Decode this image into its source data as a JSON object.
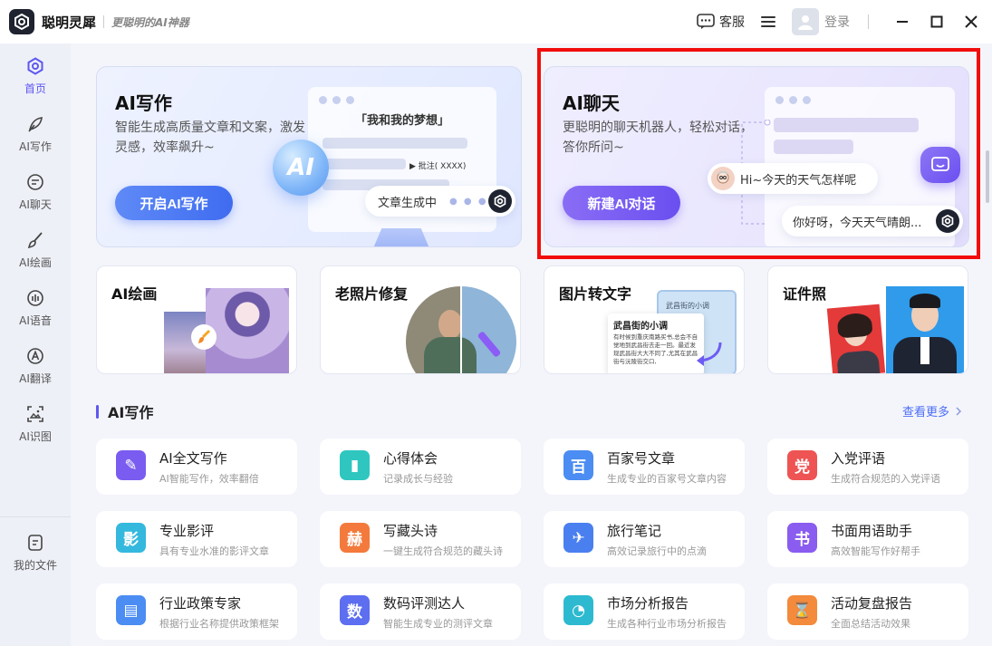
{
  "app": {
    "name": "聪明灵犀",
    "slogan": "更聪明的AI神器"
  },
  "titlebar": {
    "service_label": "客服",
    "login_label": "登录"
  },
  "sidebar": {
    "items": [
      {
        "label": "首页",
        "icon": "home-icon"
      },
      {
        "label": "AI写作",
        "icon": "pen-icon"
      },
      {
        "label": "AI聊天",
        "icon": "chat-icon"
      },
      {
        "label": "AI绘画",
        "icon": "brush-icon"
      },
      {
        "label": "AI语音",
        "icon": "voice-icon"
      },
      {
        "label": "AI翻译",
        "icon": "translate-icon"
      },
      {
        "label": "AI识图",
        "icon": "scan-icon"
      }
    ],
    "files_label": "我的文件"
  },
  "hero_write": {
    "title": "AI写作",
    "desc": "智能生成高质量文章和文案，激发灵感，效率飙升~",
    "button": "开启AI写作",
    "mock_title": "「我和我的梦想」",
    "mock_annot": "批注( XXXX)",
    "ai_badge": "AI",
    "pill_text": "文章生成中"
  },
  "hero_chat": {
    "title": "AI聊天",
    "desc": "更聪明的聊天机器人，轻松对话，答你所问~",
    "button": "新建AI对话",
    "user_msg": "Hi~今天的天气怎样呢",
    "bot_msg": "你好呀，今天天气晴朗..."
  },
  "features": [
    {
      "title": "AI绘画"
    },
    {
      "title": "老照片修复"
    },
    {
      "title": "图片转文字",
      "doc_title": "武昌街的小调",
      "doc_text": "有时候到重庆南路买书,总会不自觉地到武昌街去走一回。最近发现武昌街大大不同了,尤其在武昌街与沅陵街交口,",
      "back_doc_title": "武昌街的小调"
    },
    {
      "title": "证件照"
    }
  ],
  "section": {
    "title": "AI写作",
    "see_more": "查看更多"
  },
  "tools": [
    {
      "name": "AI全文写作",
      "desc": "AI智能写作，效率翻倍",
      "glyph": "✎",
      "color": "#7a5cf0"
    },
    {
      "name": "心得体会",
      "desc": "记录成长与经验",
      "glyph": "▮",
      "color": "#2fc6c0"
    },
    {
      "name": "百家号文章",
      "desc": "生成专业的百家号文章内容",
      "glyph": "百",
      "color": "#4b8df2"
    },
    {
      "name": "入党评语",
      "desc": "生成符合规范的入党评语",
      "glyph": "党",
      "color": "#ee5454"
    },
    {
      "name": "专业影评",
      "desc": "具有专业水准的影评文章",
      "glyph": "影",
      "color": "#34b8de"
    },
    {
      "name": "写藏头诗",
      "desc": "一键生成符合规范的藏头诗",
      "glyph": "赫",
      "color": "#f37a3c"
    },
    {
      "name": "旅行笔记",
      "desc": "高效记录旅行中的点滴",
      "glyph": "✈",
      "color": "#4a7ff0"
    },
    {
      "name": "书面用语助手",
      "desc": "高效智能写作好帮手",
      "glyph": "书",
      "color": "#8a5cf0"
    },
    {
      "name": "行业政策专家",
      "desc": "根据行业名称提供政策框架",
      "glyph": "▤",
      "color": "#4b8df2"
    },
    {
      "name": "数码评测达人",
      "desc": "智能生成专业的测评文章",
      "glyph": "数",
      "color": "#5d6ef0"
    },
    {
      "name": "市场分析报告",
      "desc": "生成各种行业市场分析报告",
      "glyph": "◔",
      "color": "#2dbad0"
    },
    {
      "name": "活动复盘报告",
      "desc": "全面总结活动效果",
      "glyph": "⌛",
      "color": "#f38a3c"
    }
  ]
}
